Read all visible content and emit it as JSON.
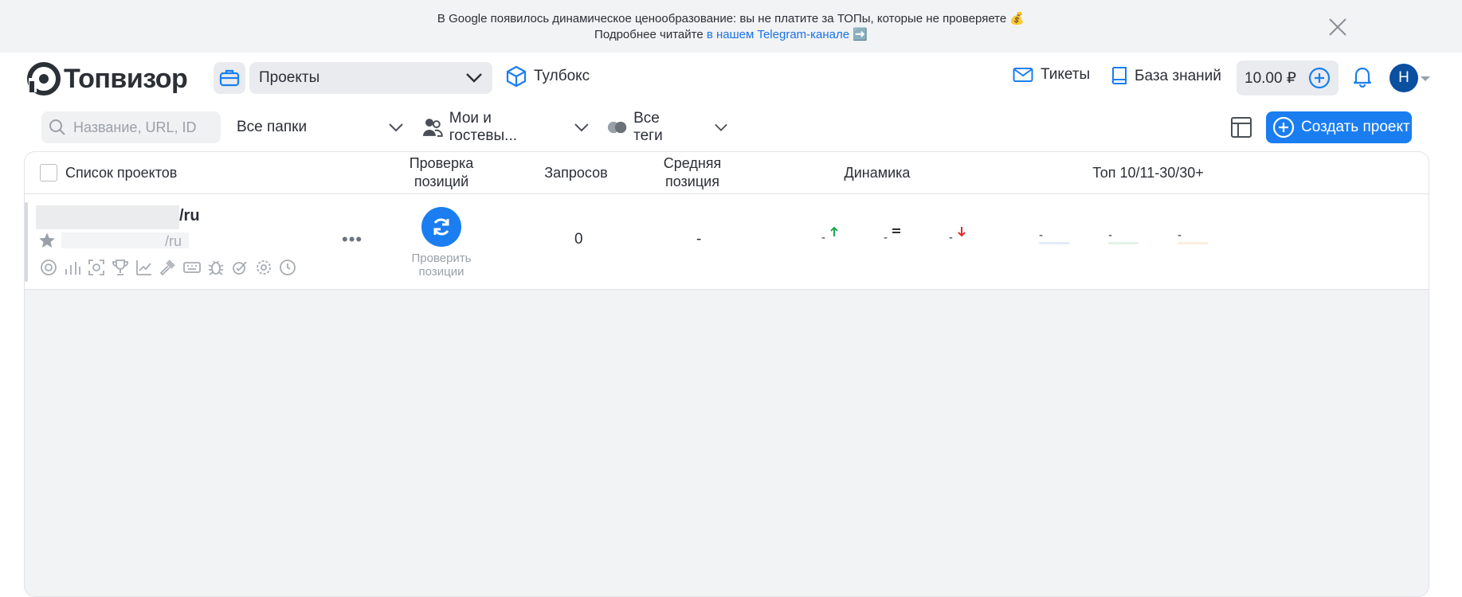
{
  "banner": {
    "line1": "В Google появилось динамическое ценообразование: вы не платите за ТОПы, которые не проверяете 💰",
    "line2_prefix": "Подробнее читайте",
    "line2_link": "в нашем Telegram-канале ➡️"
  },
  "header": {
    "logo_text": "Топвизор",
    "projects_select": "Проекты",
    "toolbox": "Тулбокс",
    "tickets": "Тикеты",
    "knowledge_base": "База знаний",
    "balance": "10.00 ₽",
    "avatar_letter": "Н"
  },
  "filters": {
    "search_placeholder": "Название, URL, ID",
    "folders": "Все папки",
    "owners": "Мои и гостевы...",
    "tags": "Все теги",
    "create_project": "Создать проект"
  },
  "table": {
    "headers": {
      "projects": "Список проектов",
      "check_positions": "Проверка позиций",
      "queries": "Запросов",
      "avg_position": "Средняя позиция",
      "dynamics": "Динамика",
      "top": "Топ 10/11-30/30+"
    },
    "row": {
      "name_suffix": "/ru",
      "url_suffix": "/ru",
      "check_label": "Проверить позиции",
      "queries": "0",
      "avg_position": "-",
      "dyn_up": "-",
      "dyn_eq": "-",
      "dyn_down": "-",
      "top10": "-",
      "top11_30": "-",
      "top30plus": "-"
    }
  },
  "colors": {
    "accent": "#1a7ef0",
    "avatar": "#0a4fa0",
    "up": "#1ea64b",
    "down": "#e5292c"
  }
}
